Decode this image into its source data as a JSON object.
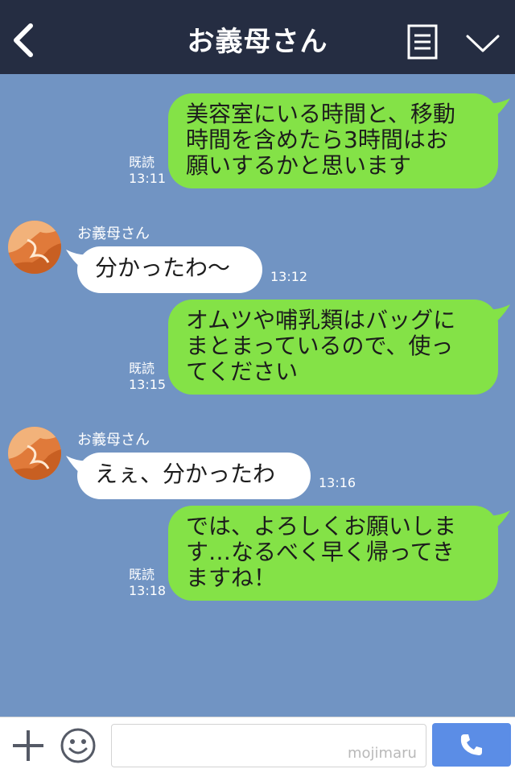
{
  "header": {
    "title": "お義母さん",
    "bg_color": "#252d42",
    "back_icon": "chevron-left-icon",
    "menu_icon": "list-icon",
    "more_icon": "chevron-down-icon"
  },
  "chat": {
    "bg_color": "#7194c3",
    "mine_bubble_color": "#84e247",
    "theirs_bubble_color": "#ffffff",
    "messages": [
      {
        "from": "me",
        "lines": [
          "美容室にいる時間と、移動",
          "時間を含めたら3時間はお",
          "願いするかと思います"
        ],
        "read": "既読",
        "time": "13:11"
      },
      {
        "from": "them",
        "sender": "お義母さん",
        "lines": [
          "分かったわ〜"
        ],
        "time": "13:12"
      },
      {
        "from": "me",
        "lines": [
          "オムツや哺乳類はバッグに",
          "まとまっているので、使っ",
          "てください"
        ],
        "read": "既読",
        "time": "13:15"
      },
      {
        "from": "them",
        "sender": "お義母さん",
        "lines": [
          "えぇ、分かったわ"
        ],
        "time": "13:16"
      },
      {
        "from": "me",
        "lines": [
          "では、よろしくお願いしま",
          "す…なるべく早く帰ってき",
          "ますね！"
        ],
        "read": "既読",
        "time": "13:18"
      }
    ]
  },
  "footer": {
    "add_icon": "plus-icon",
    "emoji_icon": "smiley-icon",
    "input_value": "",
    "watermark": "mojimaru",
    "call_icon": "phone-icon",
    "call_color": "#5b8de6"
  }
}
